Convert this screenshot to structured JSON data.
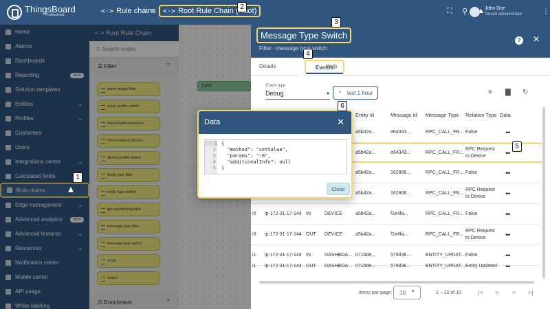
{
  "app": {
    "logo_text": "ThingsBoard",
    "logo_sub": "Professional",
    "breadcrumb": [
      {
        "label": "Rule chains"
      },
      {
        "label": "Root Rule Chain (Root)"
      }
    ],
    "breadcrumb_sep": ">",
    "user": {
      "name": "John Doe",
      "role": "Tenant administrator"
    }
  },
  "icons": [
    "home-icon",
    "alarm-icon",
    "dashboard-icon",
    "fullscreen-icon",
    "search-icon",
    "bell-icon",
    "account-icon",
    "more-vert-icon",
    "filter-icon",
    "delete-icon",
    "refresh-icon",
    "help-icon",
    "close-icon",
    "clock-icon",
    "first-page-icon",
    "chevron-left-icon",
    "chevron-right-icon",
    "last-page-icon"
  ],
  "colors": {
    "primary": "#305680",
    "highlight": "#f3d86a",
    "node": "#f3ec86",
    "input_node": "#8ec99a"
  },
  "sidebar": {
    "items": [
      {
        "label": "Home",
        "chevron": false,
        "new": false
      },
      {
        "label": "Alarms",
        "chevron": false,
        "new": false
      },
      {
        "label": "Dashboards",
        "chevron": false,
        "new": false
      },
      {
        "label": "Reporting",
        "chevron": false,
        "new": true
      },
      {
        "label": "Solution templates",
        "chevron": false,
        "new": false
      },
      {
        "label": "Entities",
        "chevron": true,
        "new": false
      },
      {
        "label": "Profiles",
        "chevron": true,
        "new": false
      },
      {
        "label": "Customers",
        "chevron": false,
        "new": false
      },
      {
        "label": "Users",
        "chevron": false,
        "new": false
      },
      {
        "label": "Integrations center",
        "chevron": true,
        "new": false
      },
      {
        "label": "Calculated fields",
        "chevron": false,
        "new": false
      },
      {
        "label": "Rule chains",
        "chevron": false,
        "new": false
      },
      {
        "label": "Edge management",
        "chevron": true,
        "new": false
      },
      {
        "label": "Advanced analytics",
        "chevron": false,
        "new": true
      },
      {
        "label": "Advanced features",
        "chevron": true,
        "new": false
      },
      {
        "label": "Resources",
        "chevron": true,
        "new": false
      },
      {
        "label": "Notification center",
        "chevron": false,
        "new": false
      },
      {
        "label": "Mobile center",
        "chevron": false,
        "new": false
      },
      {
        "label": "API usage",
        "chevron": false,
        "new": false
      },
      {
        "label": "White labeling",
        "chevron": false,
        "new": false
      }
    ],
    "new_badge": "NEW"
  },
  "library": {
    "title": "Root Rule Chain",
    "search_placeholder": "Search nodes",
    "section_filter": "Filter",
    "section_enrichment": "Enrichment",
    "nodes": [
      "alarm status filter",
      "asset profile switch",
      "check fields presence",
      "check relation presen...",
      "device profile switch",
      "entity type filter",
      "entity type switch",
      "gps geofencing filter",
      "message type filter",
      "message type switch",
      "script",
      "switch"
    ]
  },
  "canvas": {
    "input_label": "Input"
  },
  "drawer": {
    "title": "Message Type Switch",
    "subtitle": "Filter - message type switch",
    "tabs": {
      "details": "Details",
      "events": "Events",
      "help": "Help"
    },
    "event_type_label": "Event type",
    "event_type_value": "Debug",
    "time_window": "last 1 hour",
    "columns": {
      "entity_id": "Entity Id",
      "message_id": "Message Id",
      "message_type": "Message Type",
      "relation_type": "Relation Type",
      "data": "Data"
    },
    "rows": [
      {
        "server": "",
        "type": "",
        "entity": "",
        "entity_id": "a5b42a...",
        "message_id": "e64343...",
        "message_type": "RPC_CALL_FR...",
        "relation": "False"
      },
      {
        "server": "",
        "type": "",
        "entity": "",
        "entity_id": "a5b42a...",
        "message_id": "e64343...",
        "message_type": "RPC_CALL_FR...",
        "relation": "RPC Request to Device"
      },
      {
        "server": "",
        "type": "",
        "entity": "",
        "entity_id": "a5b42a...",
        "message_id": "162866...",
        "message_type": "RPC_CALL_FR...",
        "relation": "False"
      },
      {
        "server": "",
        "type": "",
        "entity": "",
        "entity_id": "a5b42a...",
        "message_id": "162866...",
        "message_type": "RPC_CALL_FR...",
        "relation": "RPC Request to Device"
      },
      {
        "server": "ip-172-31-17-144",
        "type": "IN",
        "entity": "DEVICE",
        "entity_id": "a5b42a...",
        "message_id": "f1e4fa...",
        "message_type": "RPC_CALL_FR...",
        "relation": "False"
      },
      {
        "server": "ip-172-31-17-144",
        "type": "OUT",
        "entity": "DEVICE",
        "entity_id": "a5b42a...",
        "message_id": "f1e4fa...",
        "message_type": "RPC_CALL_FR...",
        "relation": "RPC Request to Device"
      },
      {
        "server": "ip-172-31-17-144",
        "type": "IN",
        "entity": "DASHBOA...",
        "entity_id": "071bde...",
        "message_id": "579d36...",
        "message_type": "ENTITY_UPDAT...",
        "relation": "False"
      },
      {
        "server": "ip-172-31-17-144",
        "type": "OUT",
        "entity": "DASHBOA...",
        "entity_id": "071bde...",
        "message_id": "579d36...",
        "message_type": "ENTITY_UPDAT...",
        "relation": "Entity Updated"
      }
    ],
    "row_prefixes": [
      "",
      "",
      "",
      "",
      "i0",
      "i0",
      "i1",
      "i1"
    ],
    "dots": "•••",
    "pager": {
      "items_label": "Items per page:",
      "page_size": "10",
      "range": "1 – 10 of 10"
    }
  },
  "dialog": {
    "title": "Data",
    "code_lines": [
      "{",
      "  \"method\": \"setValue\",",
      "  \"params\": \"-6\",",
      "  \"additionalInfo\": null",
      "}"
    ],
    "close_label": "Close"
  },
  "annotations": [
    "1",
    "2",
    "3",
    "4",
    "5",
    "6"
  ]
}
